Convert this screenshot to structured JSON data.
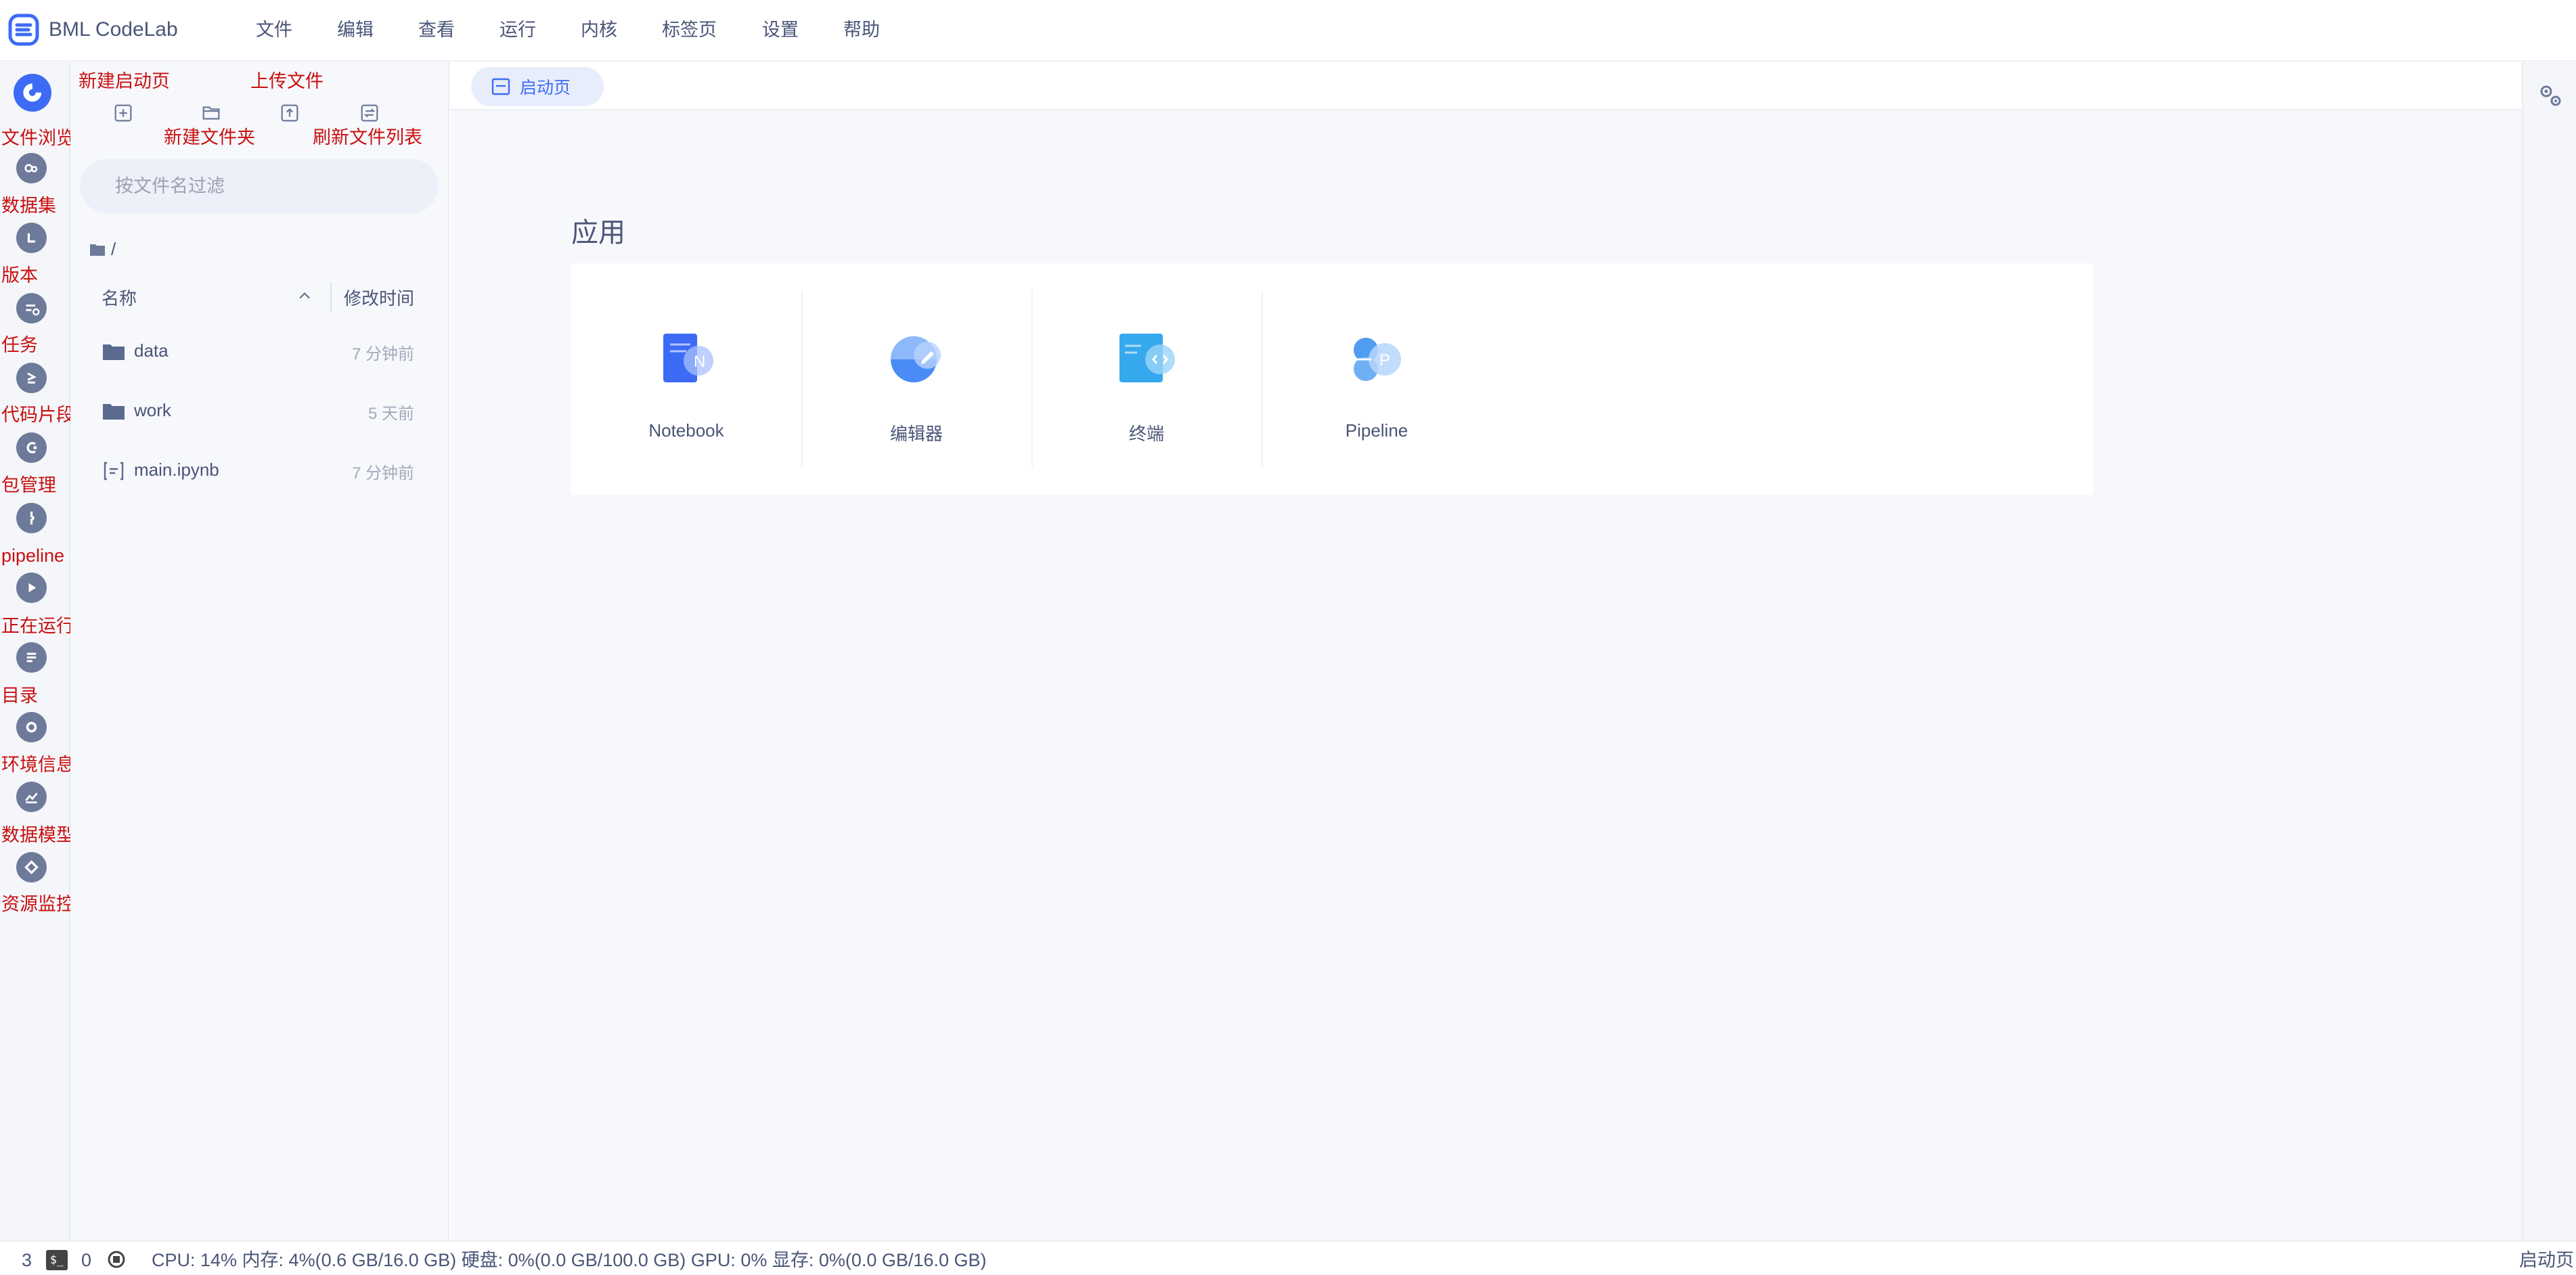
{
  "app": {
    "title": "BML CodeLab"
  },
  "menu": [
    "文件",
    "编辑",
    "查看",
    "运行",
    "内核",
    "标签页",
    "设置",
    "帮助"
  ],
  "activity_bar": {
    "items": [
      {
        "label": "文件浏览器",
        "icon": "file-browser-icon",
        "active": true
      },
      {
        "label": "数据集",
        "icon": "dataset-icon"
      },
      {
        "label": "版本",
        "icon": "version-icon"
      },
      {
        "label": "任务",
        "icon": "task-icon"
      },
      {
        "label": "代码片段",
        "icon": "code-snippet-icon"
      },
      {
        "label": "包管理",
        "icon": "package-icon"
      },
      {
        "label": "pipeline",
        "icon": "pipeline-icon"
      },
      {
        "label": "正在运行中断和内核",
        "icon": "running-icon"
      },
      {
        "label": "目录",
        "icon": "toc-icon"
      },
      {
        "label": "环境信息",
        "icon": "env-icon"
      },
      {
        "label": "数据模型可视化",
        "icon": "chart-icon"
      },
      {
        "label": "资源监控",
        "icon": "monitor-icon"
      }
    ]
  },
  "file_panel": {
    "toolbar": {
      "new_launcher": "新建启动页",
      "new_folder": "新建文件夹",
      "upload": "上传文件",
      "refresh": "刷新文件列表"
    },
    "filter_placeholder": "按文件名过滤",
    "breadcrumb": "/",
    "columns": {
      "name": "名称",
      "modified": "修改时间"
    },
    "files": [
      {
        "name": "data",
        "type": "folder",
        "modified": "7 分钟前"
      },
      {
        "name": "work",
        "type": "folder",
        "modified": "5 天前"
      },
      {
        "name": "main.ipynb",
        "type": "notebook",
        "modified": "7 分钟前"
      }
    ]
  },
  "main": {
    "tab": "启动页",
    "section_title": "应用",
    "apps": [
      {
        "label": "Notebook",
        "icon": "notebook-icon",
        "color": "#3d6bf5"
      },
      {
        "label": "编辑器",
        "icon": "editor-icon",
        "color": "#4a8cf5"
      },
      {
        "label": "终端",
        "icon": "terminal-icon",
        "color": "#35a8ee"
      },
      {
        "label": "Pipeline",
        "icon": "pipeline-app-icon",
        "color": "#4f9cf0"
      }
    ]
  },
  "status_bar": {
    "count_a": "3",
    "count_b": "0",
    "resources": "CPU:  14% 内存:  4%(0.6 GB/16.0 GB) 硬盘:  0%(0.0 GB/100.0 GB)  GPU:  0%  显存:  0%(0.0 GB/16.0 GB)",
    "right_label": "启动页"
  },
  "colors": {
    "accent": "#3d6bf5",
    "annotation_red": "#c81010",
    "icon_gray": "#6d7a99"
  }
}
